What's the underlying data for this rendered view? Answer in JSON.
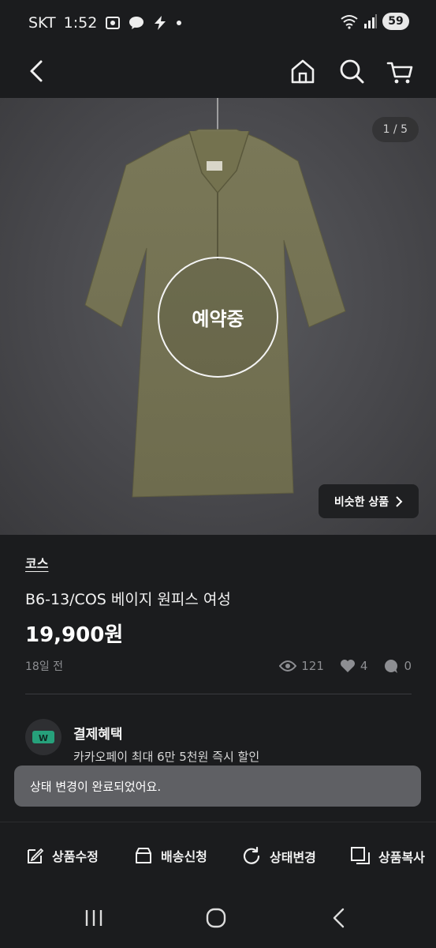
{
  "status_bar": {
    "carrier": "SKT",
    "time": "1:52",
    "battery": "59",
    "icons": [
      "screenshot-icon",
      "talk-icon",
      "bolt-icon",
      "dot-icon",
      "wifi-icon",
      "signal-icon"
    ]
  },
  "nav": {
    "icons": [
      "back-arrow-icon",
      "home-icon",
      "search-icon",
      "cart-icon"
    ]
  },
  "hero": {
    "image_counter": "1 / 5",
    "status_overlay": "예약중",
    "similar_button": "비슷한 상품"
  },
  "product": {
    "brand": "코스",
    "title": "B6-13/COS 베이지 원피스 여성",
    "price": "19,900원",
    "posted": "18일 전",
    "views": "121",
    "likes": "4",
    "chats": "0"
  },
  "benefit": {
    "title": "결제혜택",
    "description": "카카오페이 최대 6만 5천원 즉시 할인",
    "icon_text": "W"
  },
  "toast": {
    "message": "상태 변경이 완료되었어요."
  },
  "toolbar": {
    "edit": "상품수정",
    "delivery": "배송신청",
    "status": "상태변경",
    "copy": "상품복사"
  },
  "colors": {
    "background": "#1b1c1e",
    "benefit_icon": "#26a17b",
    "toast": "#5f6064"
  }
}
